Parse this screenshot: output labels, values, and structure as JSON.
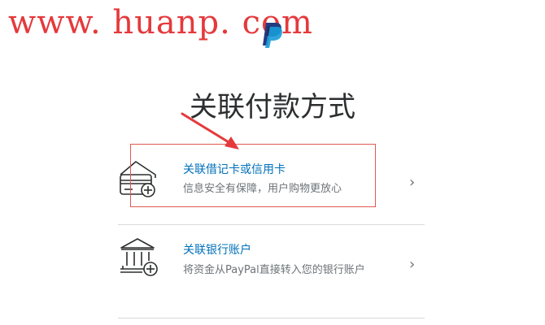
{
  "watermark": {
    "text": "www. huanp. com"
  },
  "header": {
    "logo_icon": "paypal-logo"
  },
  "page": {
    "title": "关联付款方式"
  },
  "options": [
    {
      "icon": "credit-card-icon",
      "title": "关联借记卡或信用卡",
      "description": "信息安全有保障，用户购物更放心",
      "chevron": "›",
      "highlighted": true
    },
    {
      "icon": "bank-icon",
      "title": "关联银行账户",
      "description": "将资金从PayPal直接转入您的银行账户",
      "chevron": "›",
      "highlighted": false
    }
  ],
  "colors": {
    "link_blue": "#0070ba",
    "annotation_red": "#e5393c",
    "text_gray": "#6c7378",
    "title_dark": "#2c2e2f"
  }
}
